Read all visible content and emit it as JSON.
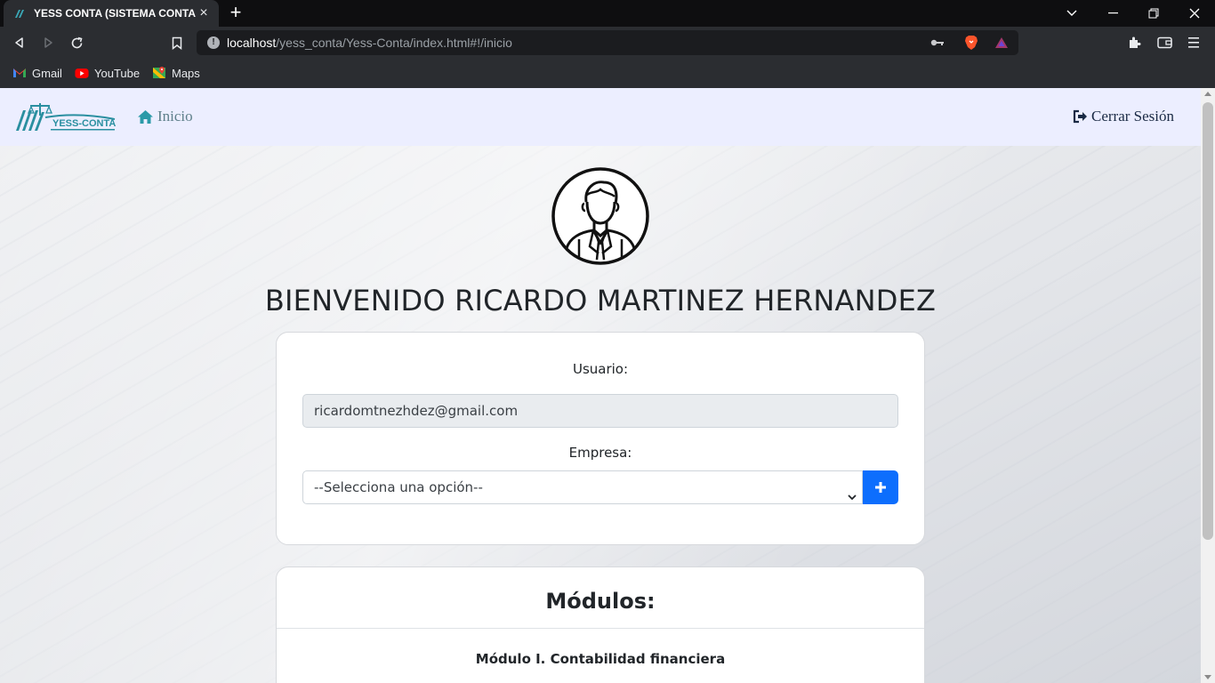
{
  "browser": {
    "tab_title": "YESS CONTA (SISTEMA CONTABLE)",
    "url_host": "localhost",
    "url_path": "/yess_conta/Yess-Conta/index.html#!/inicio",
    "bookmarks": [
      {
        "label": "Gmail",
        "icon": "gmail-icon"
      },
      {
        "label": "YouTube",
        "icon": "youtube-icon"
      },
      {
        "label": "Maps",
        "icon": "maps-icon"
      }
    ]
  },
  "navbar": {
    "logo_text": "YESS-CONTA",
    "inicio_label": "Inicio",
    "logout_label": "Cerrar Sesión"
  },
  "main": {
    "welcome": "BIENVENIDO RICARDO MARTINEZ HERNANDEZ",
    "usuario_label": "Usuario:",
    "usuario_value": "ricardomtnezhdez@gmail.com",
    "empresa_label": "Empresa:",
    "empresa_selected": "--Selecciona una opción--",
    "add_button": "+"
  },
  "modulos": {
    "title": "Módulos:",
    "items": [
      "Módulo I. Contabilidad financiera"
    ]
  },
  "colors": {
    "navbar_bg": "#eceeff",
    "accent_teal": "#2a8fa0",
    "primary_blue": "#0d6efd"
  }
}
